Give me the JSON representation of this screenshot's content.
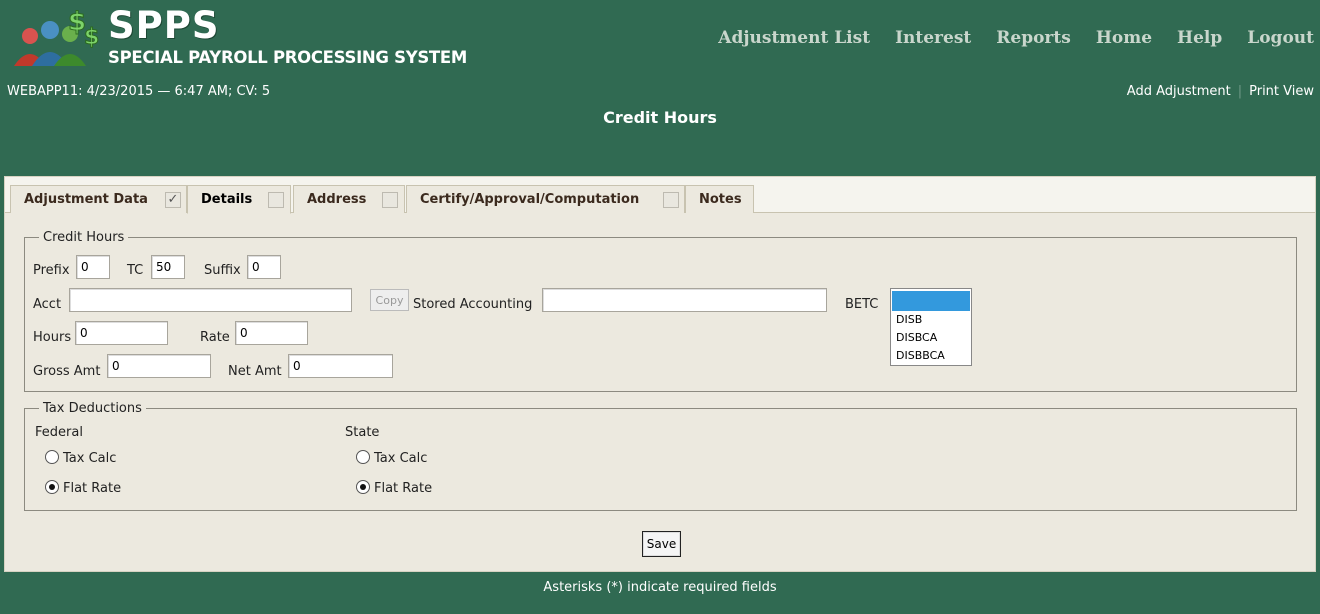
{
  "header": {
    "app_name": "SPPS",
    "app_full_name": "SPECIAL PAYROLL PROCESSING SYSTEM",
    "nav": [
      "Adjustment List",
      "Interest",
      "Reports",
      "Home",
      "Help",
      "Logout"
    ],
    "server_info": "WEBAPP11: 4/23/2015 — 6:47 AM; CV: 5",
    "add_adjustment": "Add Adjustment",
    "separator": "|",
    "print_view": "Print View"
  },
  "page_title": "Credit Hours",
  "tabs": [
    {
      "label": "Adjustment Data",
      "checked": true
    },
    {
      "label": "Details",
      "checked": false
    },
    {
      "label": "Address",
      "checked": false
    },
    {
      "label": "Certify/Approval/Computation",
      "checked": false
    },
    {
      "label": "Notes",
      "checked": null
    }
  ],
  "check_mark": "✓",
  "credit_hours": {
    "legend": "Credit Hours",
    "prefix_label": "Prefix",
    "prefix_value": "0",
    "tc_label": "TC",
    "tc_value": "50",
    "suffix_label": "Suffix",
    "suffix_value": "0",
    "acct_label": "Acct",
    "acct_value": "",
    "copy_label": "Copy",
    "stored_accounting_label": "Stored Accounting",
    "stored_accounting_value": "",
    "betc_label": "BETC",
    "betc_options": [
      "",
      "DISB",
      "DISBCA",
      "DISBBCA"
    ],
    "betc_selected": "",
    "hours_label": "Hours",
    "hours_value": "0",
    "rate_label": "Rate",
    "rate_value": "0",
    "gross_label": "Gross Amt",
    "gross_value": "0",
    "net_label": "Net Amt",
    "net_value": "0"
  },
  "tax": {
    "legend": "Tax Deductions",
    "federal_label": "Federal",
    "state_label": "State",
    "tax_calc_label": "Tax Calc",
    "flat_rate_label": "Flat Rate",
    "federal_selected": "Flat Rate",
    "state_selected": "Flat Rate"
  },
  "save_label": "Save",
  "footer_text": "Asterisks (*) indicate required fields"
}
